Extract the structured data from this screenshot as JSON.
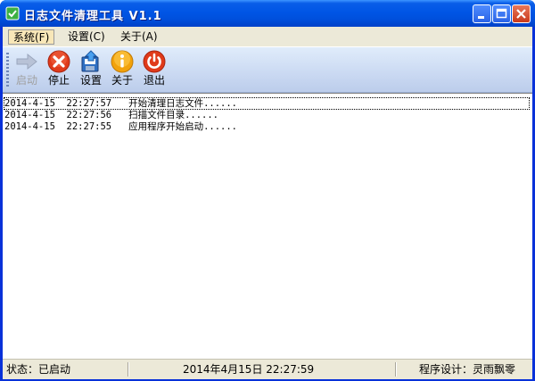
{
  "window": {
    "title": "日志文件清理工具 V1.1"
  },
  "menu": {
    "items": [
      {
        "label": "系统(F)"
      },
      {
        "label": "设置(C)"
      },
      {
        "label": "关于(A)"
      }
    ]
  },
  "toolbar": {
    "start_label": "启动",
    "stop_label": "停止",
    "settings_label": "设置",
    "about_label": "关于",
    "exit_label": "退出"
  },
  "log": {
    "rows": [
      {
        "text": "2014-4-15  22:27:57   开始清理日志文件......"
      },
      {
        "text": "2014-4-15  22:27:56   扫描文件目录......"
      },
      {
        "text": "2014-4-15  22:27:55   应用程序开始启动......"
      }
    ]
  },
  "status": {
    "state": "状态：已启动",
    "datetime": "2014年4月15日    22:27:59",
    "designer": "程序设计：灵雨飘零"
  },
  "colors": {
    "titlebar": "#0055e5",
    "stop_icon": "#e03a1a",
    "exit_icon": "#e03a1a",
    "about_icon": "#f2a20b",
    "settings_icon": "#2f6fc2",
    "start_icon_disabled": "#b8c2d6"
  }
}
